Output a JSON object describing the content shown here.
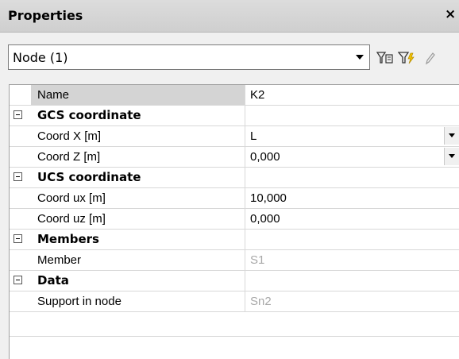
{
  "panel": {
    "title": "Properties",
    "close_glyph": "×"
  },
  "selector": {
    "value": "Node (1)",
    "icons": [
      "dropdown-arrow-icon",
      "filter-selection-icon",
      "quick-filter-icon",
      "edit-pencil-icon"
    ]
  },
  "rows": [
    {
      "kind": "prop",
      "name": "Name",
      "value": "K2",
      "selected": true
    },
    {
      "kind": "cat",
      "name": "GCS coordinate"
    },
    {
      "kind": "prop",
      "name": "Coord X [m]",
      "value": "L",
      "dropdown": true
    },
    {
      "kind": "prop",
      "name": "Coord Z [m]",
      "value": "0,000",
      "dropdown": true
    },
    {
      "kind": "cat",
      "name": "UCS coordinate"
    },
    {
      "kind": "prop",
      "name": "Coord ux [m]",
      "value": "10,000"
    },
    {
      "kind": "prop",
      "name": "Coord uz [m]",
      "value": "0,000"
    },
    {
      "kind": "cat",
      "name": "Members"
    },
    {
      "kind": "prop",
      "name": "Member",
      "value": "S1",
      "disabled": true
    },
    {
      "kind": "cat",
      "name": "Data"
    },
    {
      "kind": "prop",
      "name": "Support in node",
      "value": "Sn2",
      "disabled": true
    }
  ]
}
